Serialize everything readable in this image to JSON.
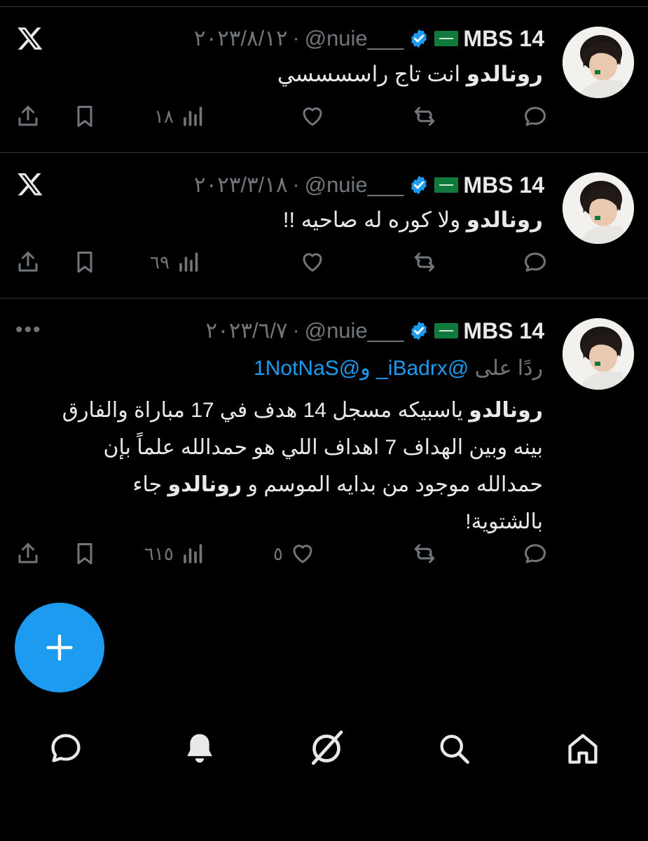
{
  "tweets": [
    {
      "name": "MBS 14",
      "handle": "@nuie___",
      "separator": "·",
      "date": "٢٠٢٣/٨/١٢",
      "text_bold": "رونالدو",
      "text_rest": " انت تاج راسسسسي",
      "corner_icon": "x-logo-icon",
      "views": "١٨",
      "likes": "",
      "retweets": "",
      "replies": ""
    },
    {
      "name": "MBS 14",
      "handle": "@nuie___",
      "separator": "·",
      "date": "٢٠٢٣/٣/١٨",
      "text_bold": "رونالدو",
      "text_rest": " ولا كوره له صاحيه !!",
      "corner_icon": "x-logo-icon",
      "views": "٦٩",
      "likes": "",
      "retweets": "",
      "replies": ""
    },
    {
      "name": "MBS 14",
      "handle": "@nuie___",
      "separator": "·",
      "date": "٢٠٢٣/٦/٧",
      "reply_prefix": "ردًا على ",
      "reply_mention_1": "@iBadrx_",
      "reply_and": " و",
      "reply_mention_2": "@1NotNaS",
      "line1_bold": "رونالدو",
      "line1_rest": " ياسبيكه مسجل 14 هدف في 17 مباراة والفارق",
      "line2": "بينه وبين الهداف 7 اهداف اللي هو حمدالله علماً بإن",
      "line3_a": "حمدالله موجود من بدايه الموسم و ",
      "line3_bold": "رونالدو",
      "line3_b": " جاء",
      "line4": "بالشتوية!",
      "corner_icon": "more-icon",
      "corner_text": "•••",
      "views": "٦١٥",
      "likes": "٥",
      "retweets": "",
      "replies": ""
    }
  ],
  "colors": {
    "background": "#000000",
    "text": "#e7e9ea",
    "muted": "#71767b",
    "accent": "#1d9bf0",
    "verified": "#1d9bf0",
    "divider": "#2f3336"
  },
  "fab": {
    "icon": "plus-icon",
    "label": "+"
  },
  "bottom_nav": [
    {
      "icon": "messages-icon"
    },
    {
      "icon": "notifications-bell-icon"
    },
    {
      "icon": "grok-icon"
    },
    {
      "icon": "search-icon"
    },
    {
      "icon": "home-icon"
    }
  ]
}
